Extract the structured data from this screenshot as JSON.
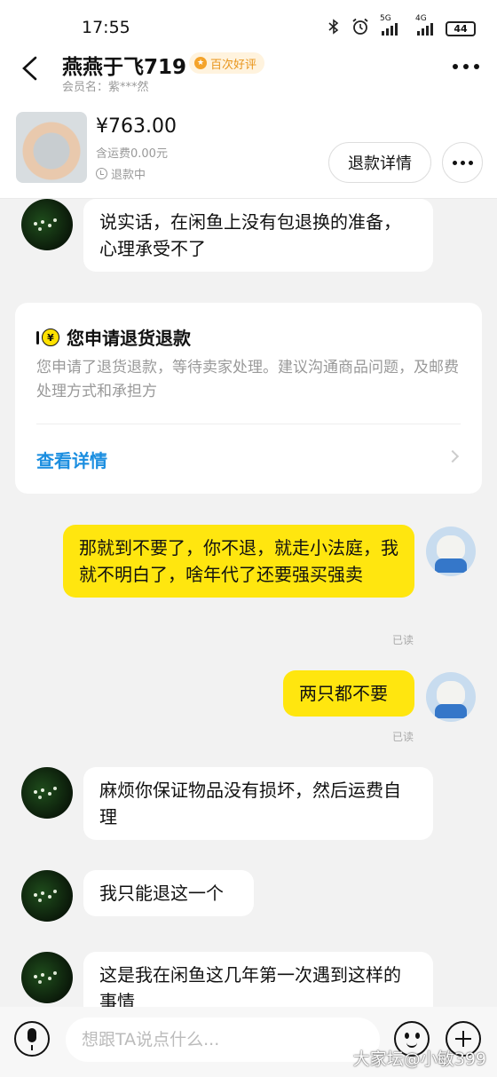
{
  "status_bar": {
    "time": "17:55",
    "net1": "5G",
    "net2": "4G",
    "battery": "44"
  },
  "header": {
    "title": "燕燕于飞719",
    "badge": "百次好评",
    "badge_icon": "medal-icon",
    "member": "会员名：紫***然"
  },
  "product": {
    "price": "¥763.00",
    "shipping": "含运费0.00元",
    "status": "退款中",
    "refund_button": "退款详情"
  },
  "messages": [
    {
      "side": "in",
      "text": "说实话，在闲鱼上没有包退换的准备，心理承受不了"
    },
    {
      "side": "out",
      "text": "那就到不要了，你不退，就走小法庭，我就不明白了，啥年代了还要强买强卖",
      "read": "已读"
    },
    {
      "side": "out",
      "text": "两只都不要",
      "read": "已读"
    },
    {
      "side": "in",
      "text": "麻烦你保证物品没有损坏，然后运费自理"
    },
    {
      "side": "in",
      "text": "我只能退这一个"
    },
    {
      "side": "in",
      "text": "这是我在闲鱼这几年第一次遇到这样的事情"
    }
  ],
  "refund_card": {
    "title": "您申请退货退款",
    "coin_glyph": "¥",
    "description": "您申请了退货退款，等待卖家处理。建议沟通商品问题，及邮费处理方式和承担方",
    "link": "查看详情"
  },
  "input": {
    "placeholder": "想跟TA说点什么..."
  },
  "watermark": "大家坛@小敏399",
  "colors": {
    "outgoing_bubble": "#ffe60f",
    "link": "#1b8ee0",
    "badge_text": "#e8941a"
  }
}
